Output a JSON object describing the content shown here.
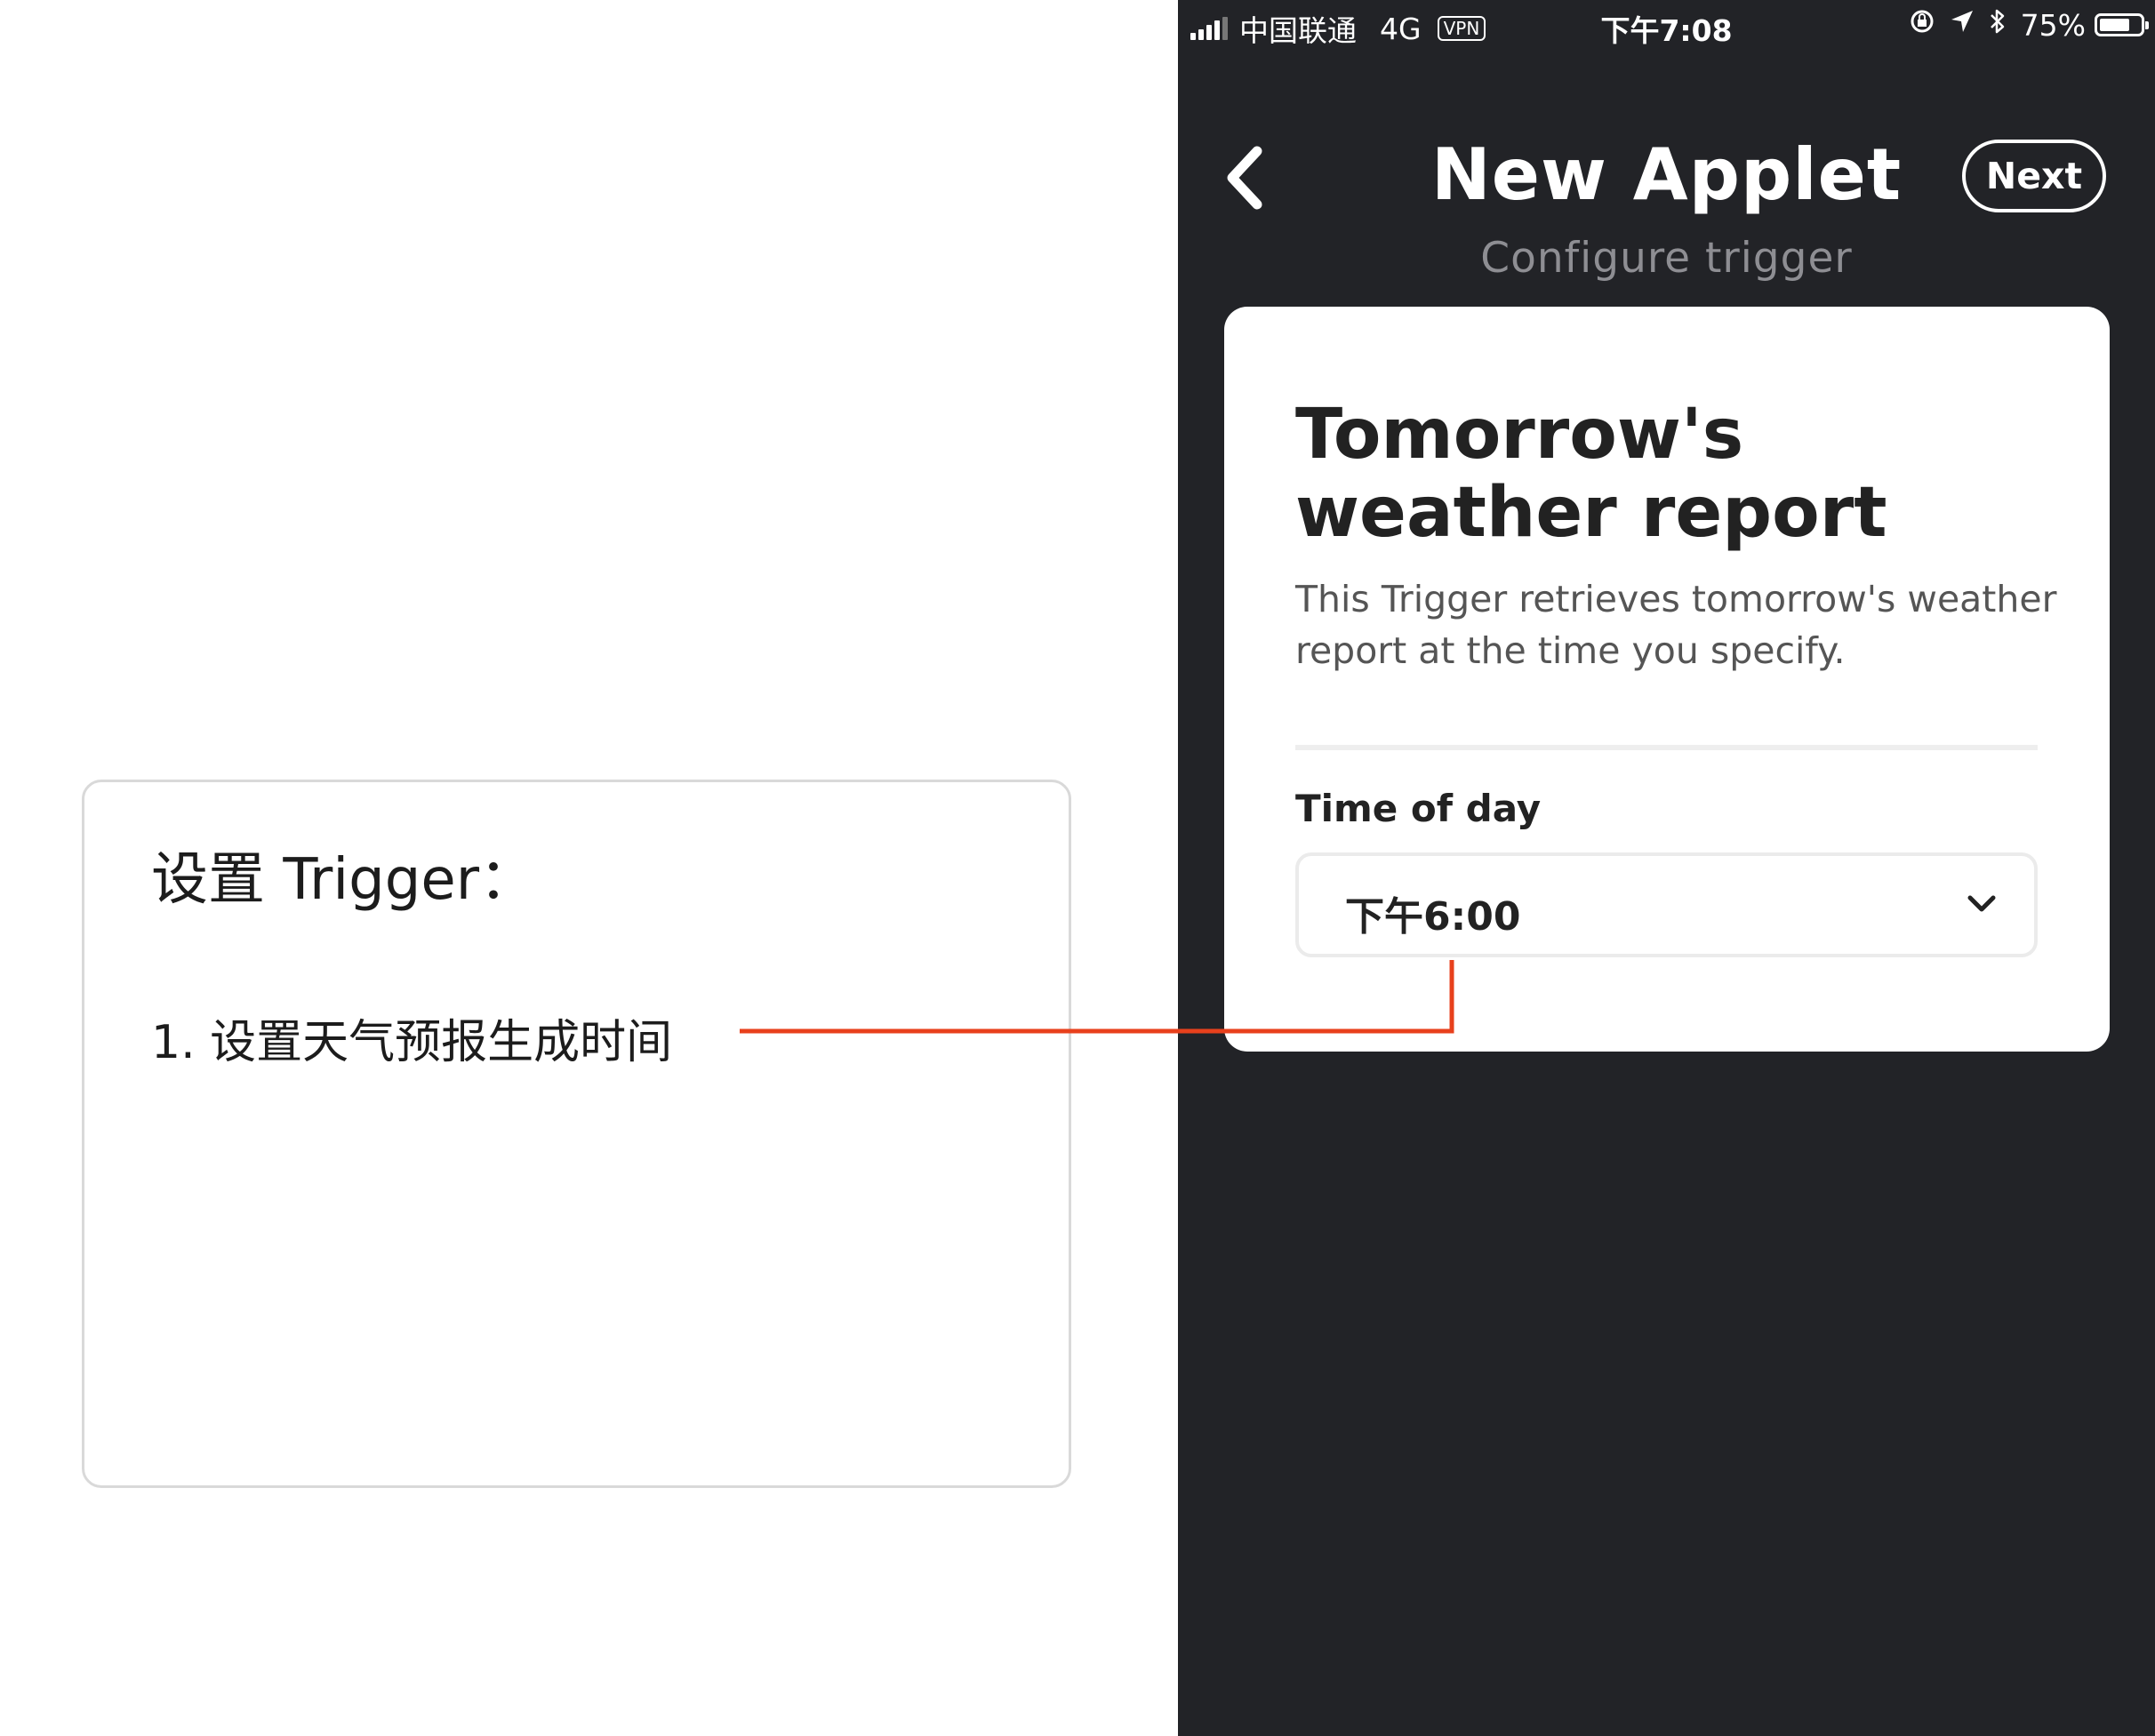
{
  "annotation": {
    "title": "设置 Trigger：",
    "step_1": "1. 设置天气预报生成时间",
    "connector_color": "#e8401c"
  },
  "status_bar": {
    "carrier": "中国联通",
    "network": "4G",
    "vpn": "VPN",
    "time": "下午7:08",
    "battery": "75%",
    "battery_level": 0.75,
    "icons": [
      "signal-icon",
      "orientation-lock-icon",
      "location-arrow-icon",
      "bluetooth-icon",
      "battery-icon"
    ]
  },
  "nav": {
    "title": "New Applet",
    "subtitle": "Configure trigger",
    "next_label": "Next",
    "back_icon": "chevron-left-icon"
  },
  "card": {
    "title": "Tomorrow's weather report",
    "description": "This Trigger retrieves tomorrow's weather report at the time you specify.",
    "field_label": "Time of day",
    "time_value": "下午6:00",
    "dropdown_icon": "chevron-down-icon"
  },
  "colors": {
    "phone_background": "#222327",
    "card_background": "#ffffff",
    "subtitle": "#8e8e93",
    "accent_line": "#e8401c"
  }
}
